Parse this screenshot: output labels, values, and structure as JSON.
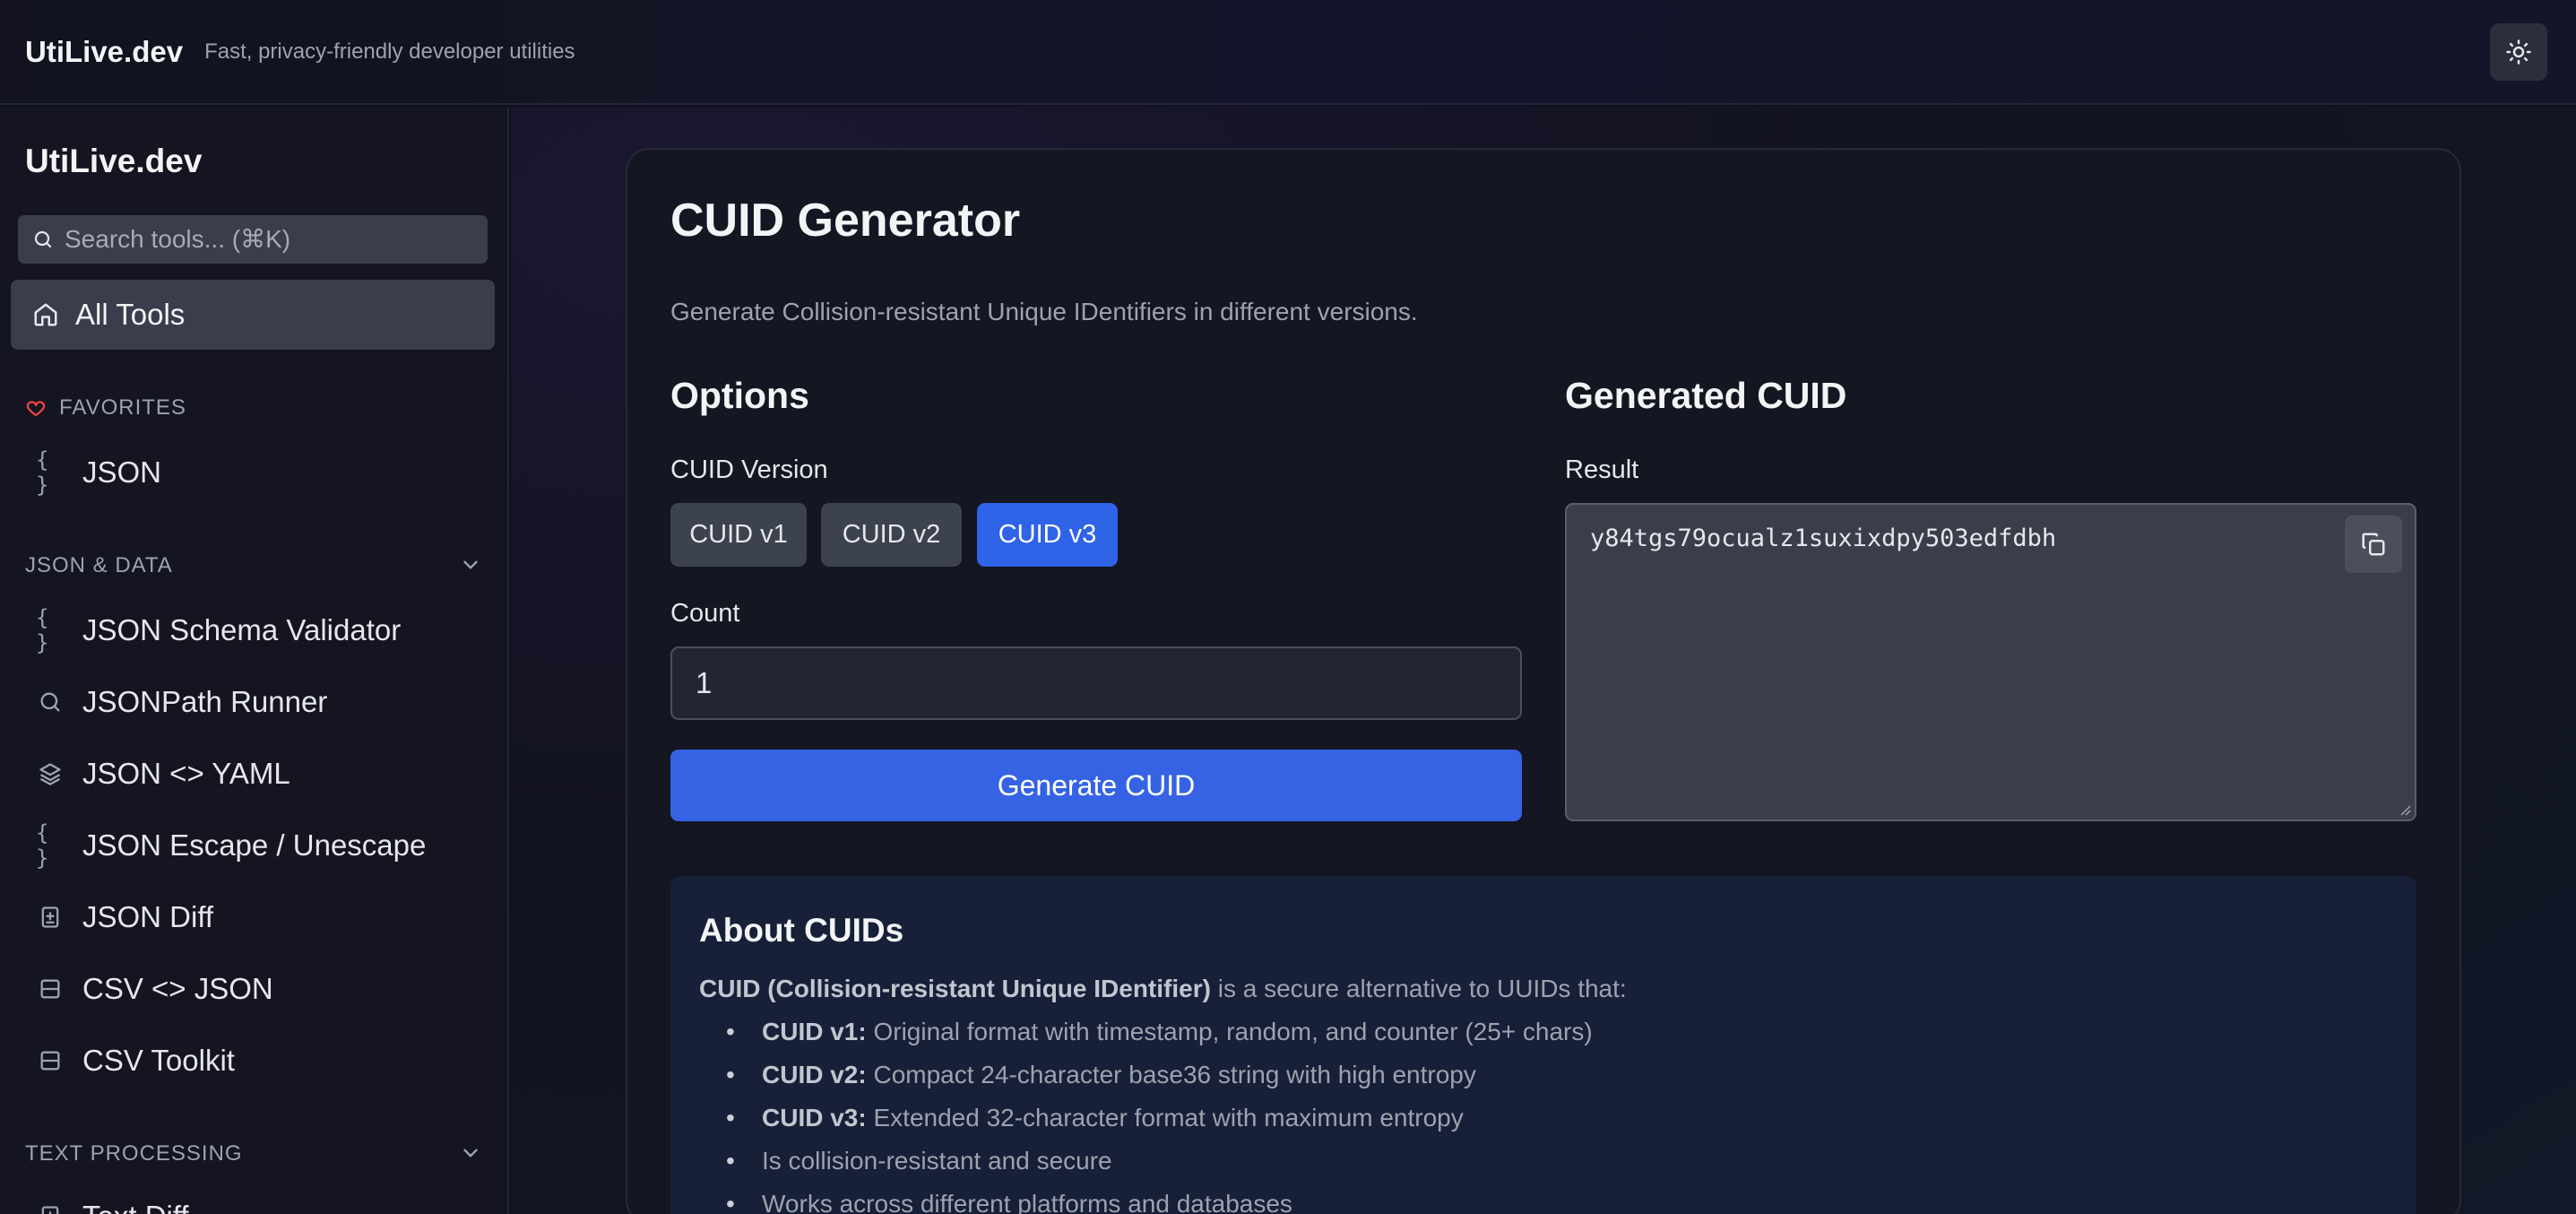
{
  "header": {
    "brand": "UtiLive.dev",
    "tagline": "Fast, privacy-friendly developer utilities"
  },
  "sidebar": {
    "brand": "UtiLive.dev",
    "search_placeholder": "Search tools... (⌘K)",
    "all_tools": "All Tools",
    "favorites_label": "FAVORITES",
    "favorites": [
      {
        "label": "JSON",
        "icon": "braces-icon"
      }
    ],
    "sections": [
      {
        "label": "JSON & DATA",
        "items": [
          {
            "label": "JSON Schema Validator",
            "icon": "braces-icon"
          },
          {
            "label": "JSONPath Runner",
            "icon": "search-icon"
          },
          {
            "label": "JSON <> YAML",
            "icon": "layers-icon"
          },
          {
            "label": "JSON Escape / Unescape",
            "icon": "braces-icon"
          },
          {
            "label": "JSON Diff",
            "icon": "file-diff-icon"
          },
          {
            "label": "CSV <> JSON",
            "icon": "table-icon"
          },
          {
            "label": "CSV Toolkit",
            "icon": "table-icon"
          }
        ]
      },
      {
        "label": "TEXT PROCESSING",
        "items": [
          {
            "label": "Text Diff",
            "icon": "file-diff-icon"
          }
        ]
      }
    ]
  },
  "main": {
    "title": "CUID Generator",
    "subtitle": "Generate Collision-resistant Unique IDentifiers in different versions.",
    "options": {
      "heading": "Options",
      "version_label": "CUID Version",
      "versions": [
        "CUID v1",
        "CUID v2",
        "CUID v3"
      ],
      "selected_version": "CUID v3",
      "count_label": "Count",
      "count_value": "1",
      "generate_button": "Generate CUID"
    },
    "output": {
      "heading": "Generated CUID",
      "result_label": "Result",
      "result_value": "y84tgs79ocualz1suxixdpy503edfdbh"
    },
    "about": {
      "title": "About CUIDs",
      "intro_bold": "CUID (Collision-resistant Unique IDentifier)",
      "intro_rest": " is a secure alternative to UUIDs that:",
      "points": [
        {
          "bold": "CUID v1:",
          "text": " Original format with timestamp, random, and counter (25+ chars)"
        },
        {
          "bold": "CUID v2:",
          "text": " Compact 24-character base36 string with high entropy"
        },
        {
          "bold": "CUID v3:",
          "text": " Extended 32-character format with maximum entropy"
        },
        {
          "bold": "",
          "text": "Is collision-resistant and secure"
        },
        {
          "bold": "",
          "text": "Works across different platforms and databases"
        }
      ]
    }
  },
  "colors": {
    "accent": "#3563e4",
    "favorite_heart": "#ef4444",
    "background": "#0f1120"
  }
}
